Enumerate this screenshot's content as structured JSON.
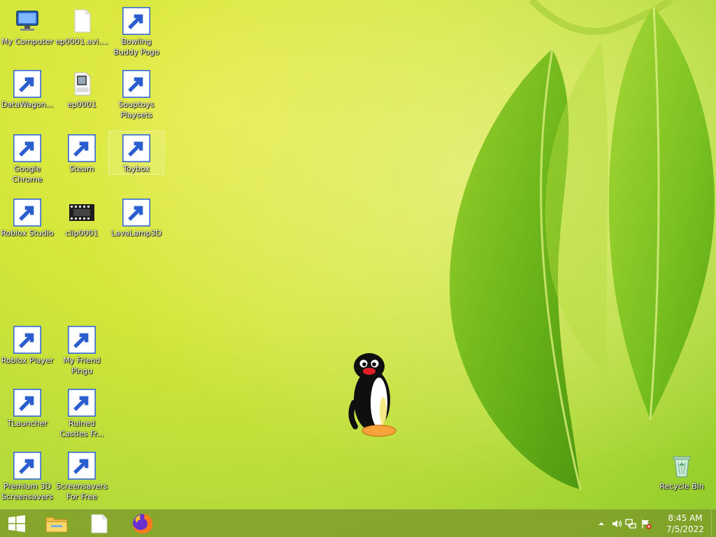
{
  "desktop": {
    "icons": [
      {
        "label": "My Computer",
        "icon": "computer-icon"
      },
      {
        "label": "ep0001.avi....",
        "icon": "blank-file-icon"
      },
      {
        "label": "Bowling Buddy Pogo",
        "icon": "bowling-game-icon"
      },
      {
        "label": "DataWagon...",
        "icon": "datawagon-icon"
      },
      {
        "label": "ep0001",
        "icon": "avi-file-icon"
      },
      {
        "label": "Souptoys Playsets",
        "icon": "blank-file-icon"
      },
      {
        "label": "Google Chrome",
        "icon": "blank-file-icon"
      },
      {
        "label": "Steam",
        "icon": "steam-icon"
      },
      {
        "label": "Toybox",
        "icon": "toybox-icon"
      },
      {
        "label": "Roblox Studio",
        "icon": "roblox-studio-icon"
      },
      {
        "label": "clip0001",
        "icon": "video-clip-icon"
      },
      {
        "label": "LavaLamp3D",
        "icon": "lava-lamp-icon"
      },
      {
        "label": "Roblox Player",
        "icon": "roblox-player-icon"
      },
      {
        "label": "My Friend Pingu",
        "icon": "pingu-icon"
      },
      {
        "label": "TLauncher",
        "icon": "tlauncher-icon"
      },
      {
        "label": "Ruined Castles Fr...",
        "icon": "ruined-castles-icon"
      },
      {
        "label": "Premium 3D Screensavers",
        "icon": "screensaver-icon"
      },
      {
        "label": "Screensavers For Free",
        "icon": "monitor-icon"
      },
      {
        "label": "Recycle Bin",
        "icon": "recycle-bin-icon"
      }
    ],
    "selected_icon": "Toybox"
  },
  "taskbar": {
    "start_icon": "windows-start-icon",
    "pinned": [
      "file-explorer-icon",
      "blank-document-icon",
      "firefox-icon"
    ],
    "tray": {
      "icons": [
        "show-hidden-icons-chevron",
        "volume-icon",
        "network-icon",
        "action-center-flag-icon"
      ],
      "time": "8:45 AM",
      "date": "7/5/2022"
    }
  },
  "colors": {
    "taskbar_bg": "#7f9a2a",
    "label_text": "#ffffff",
    "wallpaper_top": "#e6ec4a",
    "wallpaper_bottom": "#8fcc2a"
  }
}
